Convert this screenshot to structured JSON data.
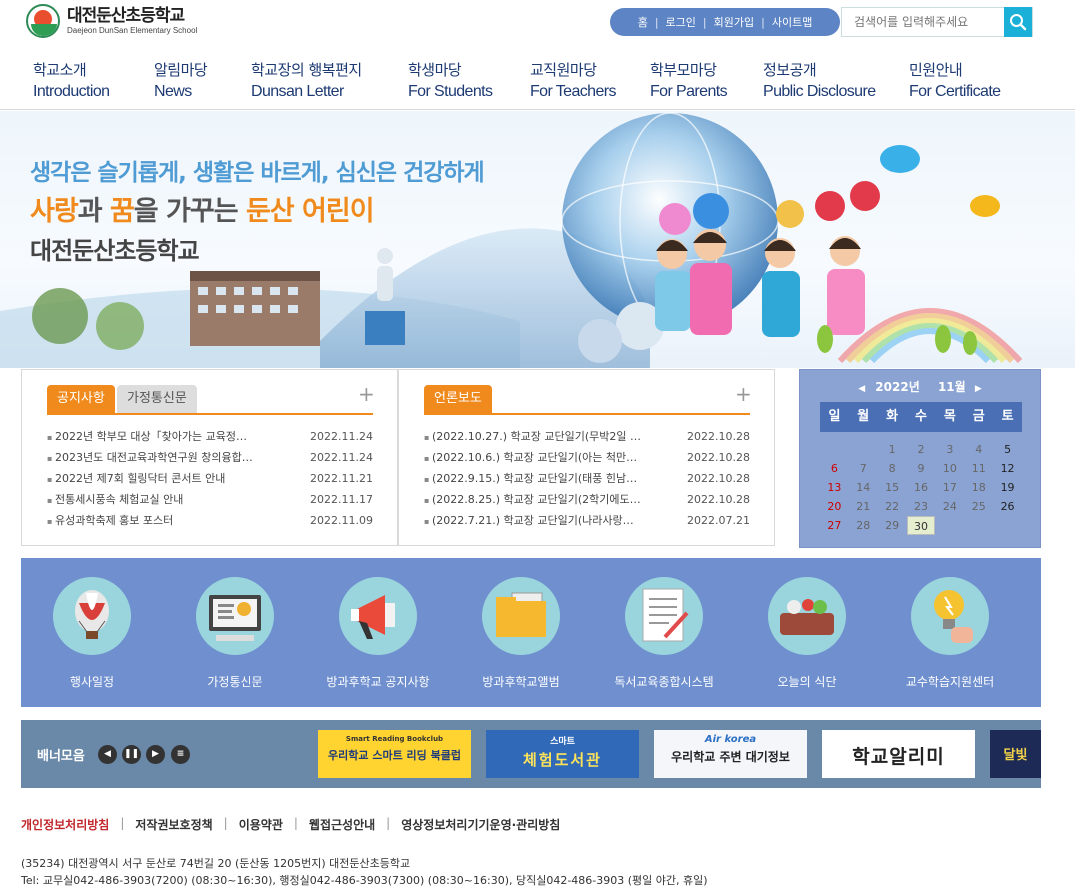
{
  "logo": {
    "title": "대전둔산초등학교",
    "subtitle": "Daejeon DunSan Elementary School"
  },
  "util": {
    "home": "홈",
    "login": "로그인",
    "join": "회원가입",
    "sitemap": "사이트맵"
  },
  "search": {
    "placeholder": "검색어를 입력해주세요"
  },
  "gnb": [
    {
      "ko": "학교소개",
      "en": "Introduction"
    },
    {
      "ko": "알림마당",
      "en": "News"
    },
    {
      "ko": "학교장의 행복편지",
      "en": "Dunsan Letter"
    },
    {
      "ko": "학생마당",
      "en": "For Students"
    },
    {
      "ko": "교직원마당",
      "en": "For Teachers"
    },
    {
      "ko": "학부모마당",
      "en": "For Parents"
    },
    {
      "ko": "정보공개",
      "en": "Public Disclosure"
    },
    {
      "ko": "민원안내",
      "en": "For Certificate"
    }
  ],
  "hero": {
    "line1": "생각은 슬기롭게, 생활은 바르게, 심신은 건강하게",
    "line2_a": "사랑",
    "line2_b": "과 ",
    "line2_c": "꿈",
    "line2_d": "을 가꾸는 ",
    "line2_e": "둔산 어린이",
    "line3": "대전둔산초등학교"
  },
  "notice": {
    "tab1": "공지사항",
    "tab2": "가정통신문",
    "more": "+",
    "items": [
      {
        "title": "2022년 학부모 대상「찾아가는 교육정…",
        "date": "2022.11.24"
      },
      {
        "title": "2023년도 대전교육과학연구원 창의융합…",
        "date": "2022.11.24"
      },
      {
        "title": "2022년 제7회 힐링닥터 콘서트 안내",
        "date": "2022.11.21"
      },
      {
        "title": "전통세시풍속 체험교실 안내",
        "date": "2022.11.17"
      },
      {
        "title": "유성과학축제 홍보 포스터",
        "date": "2022.11.09"
      }
    ]
  },
  "press": {
    "tab1": "언론보도",
    "more": "+",
    "items": [
      {
        "title": "(2022.10.27.) 학교장 교단일기(무박2일 …",
        "date": "2022.10.28"
      },
      {
        "title": "(2022.10.6.) 학교장 교단일기(아는 척만…",
        "date": "2022.10.28"
      },
      {
        "title": "(2022.9.15.) 학교장 교단일기(태풍 힌남…",
        "date": "2022.10.28"
      },
      {
        "title": "(2022.8.25.) 학교장 교단일기(2학기에도…",
        "date": "2022.10.28"
      },
      {
        "title": "(2022.7.21.) 학교장 교단일기(나라사랑…",
        "date": "2022.07.21"
      }
    ]
  },
  "calendar": {
    "prev": "◀",
    "next": "▶",
    "year": "2022년",
    "month": "11월",
    "dow": [
      "일",
      "월",
      "화",
      "수",
      "목",
      "금",
      "토"
    ],
    "today": "30",
    "weeks": [
      [
        "",
        "",
        "1",
        "2",
        "3",
        "4",
        "5"
      ],
      [
        "6",
        "7",
        "8",
        "9",
        "10",
        "11",
        "12"
      ],
      [
        "13",
        "14",
        "15",
        "16",
        "17",
        "18",
        "19"
      ],
      [
        "20",
        "21",
        "22",
        "23",
        "24",
        "25",
        "26"
      ],
      [
        "27",
        "28",
        "29",
        "30",
        "",
        "",
        ""
      ]
    ]
  },
  "quick": [
    {
      "label": "행사일정",
      "icon": "balloon-icon"
    },
    {
      "label": "가정통신문",
      "icon": "monitor-icon"
    },
    {
      "label": "방과후학교 공지사항",
      "icon": "megaphone-icon"
    },
    {
      "label": "방과후학교앨범",
      "icon": "folder-icon"
    },
    {
      "label": "독서교육종합시스템",
      "icon": "document-icon"
    },
    {
      "label": "오늘의 식단",
      "icon": "meal-icon"
    },
    {
      "label": "교수학습지원센터",
      "icon": "lightbulb-icon"
    }
  ],
  "banner": {
    "title": "배너모음",
    "items": [
      {
        "top": "Smart Reading Bookclub",
        "main": "우리학교 스마트 리딩 북클럽"
      },
      {
        "top": "스마트",
        "main": "체험도서관"
      },
      {
        "top": "Air korea",
        "main": "우리학교 주변 대기정보"
      },
      {
        "top": "",
        "main": "학교알리미"
      },
      {
        "top": "",
        "main": "달빛"
      }
    ]
  },
  "footer": {
    "links": [
      "개인정보처리방침",
      "저작권보호정책",
      "이용약관",
      "웹접근성안내",
      "영상정보처리기기운영·관리방침"
    ],
    "address": "(35234) 대전광역시 서구 둔산로 74번길 20 (둔산동 1205번지) 대전둔산초등학교",
    "tel": "Tel: 교무실042-486-3903(7200) (08:30~16:30), 행정실042-486-3903(7300) (08:30~16:30), 당직실042-486-3903 (평일 야간, 휴일)"
  },
  "colors": {
    "accent": "#f08a1c",
    "nav": "#1d3a73",
    "util": "#5d84c4",
    "quick_bg": "#6f8fcf",
    "calendar_bg": "#8aa3d3"
  }
}
